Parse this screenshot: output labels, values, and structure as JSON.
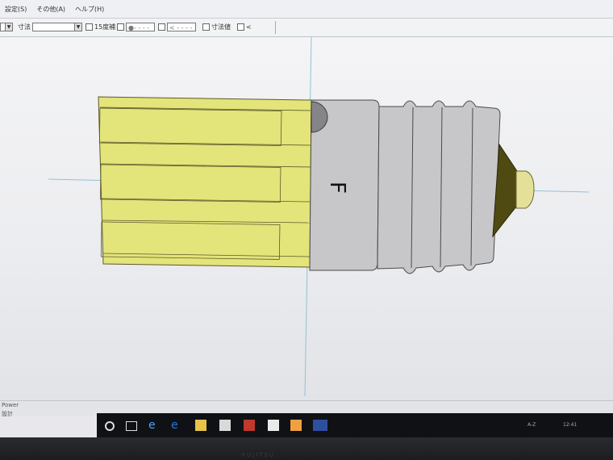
{
  "menu": {
    "items": [
      "設定(S)",
      "その他(A)",
      "ヘルプ(H)"
    ]
  },
  "toolbar": {
    "size_label": "寸法",
    "checks": [
      {
        "label": "15度補"
      },
      {
        "label": "寸法値"
      },
      {
        "label": "<"
      }
    ],
    "line_style_a": "●- - - -",
    "line_style_b": "< - - - -"
  },
  "drawing": {
    "letter": "F",
    "colors": {
      "yellow": "#e3e47a",
      "gray": "#c7c7c9",
      "dark_tip": "#4e4a12",
      "bulb_tip": "#e5e099",
      "guide": "#8fc2d4"
    }
  },
  "statusbar": {
    "left_top": "Power",
    "left_bottom": "設計"
  },
  "taskbar": {
    "tray_text": [
      "A-Z",
      "12:41"
    ]
  },
  "bezel": {
    "brand": "FUJITSU"
  }
}
